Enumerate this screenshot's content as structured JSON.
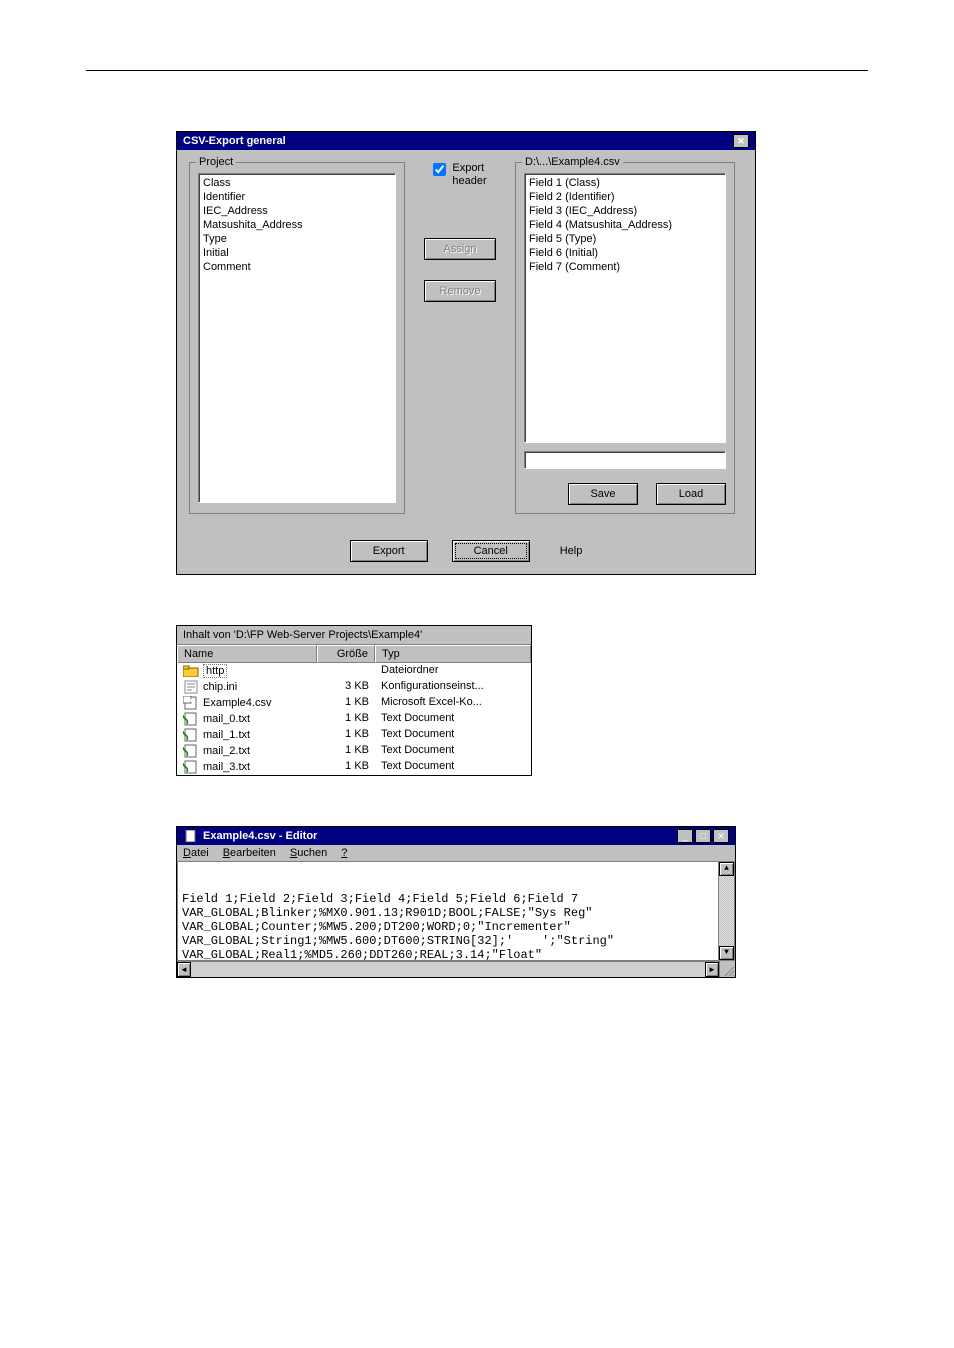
{
  "dialog": {
    "title": "CSV-Export general",
    "project_legend": "Project",
    "project_items": "Class\nIdentifier\nIEC_Address\nMatsushita_Address\nType\nInitial\nComment",
    "export_header_label": "Export\nheader",
    "assign_label": "Assign",
    "remove_label": "Remove",
    "dest_legend": "D:\\...\\Example4.csv",
    "dest_items": "Field 1 (Class)\nField 2 (Identifier)\nField 3 (IEC_Address)\nField 4 (Matsushita_Address)\nField 5 (Type)\nField 6 (Initial)\nField 7 (Comment)",
    "save_label": "Save",
    "load_label": "Load",
    "export_label": "Export",
    "cancel_label": "Cancel",
    "help_label": "Help"
  },
  "explorer": {
    "header": "Inhalt von 'D:\\FP Web-Server Projects\\Example4'",
    "col_name": "Name",
    "col_size": "Größe",
    "col_type": "Typ",
    "rows": [
      {
        "icon": "folder",
        "name": "http",
        "selected": true,
        "size": "",
        "type": "Dateiordner"
      },
      {
        "icon": "ini",
        "name": "chip.ini",
        "selected": false,
        "size": "3 KB",
        "type": "Konfigurationseinst..."
      },
      {
        "icon": "csv",
        "name": "Example4.csv",
        "selected": false,
        "size": "1 KB",
        "type": "Microsoft Excel-Ko..."
      },
      {
        "icon": "txt",
        "name": "mail_0.txt",
        "selected": false,
        "size": "1 KB",
        "type": "Text Document"
      },
      {
        "icon": "txt",
        "name": "mail_1.txt",
        "selected": false,
        "size": "1 KB",
        "type": "Text Document"
      },
      {
        "icon": "txt",
        "name": "mail_2.txt",
        "selected": false,
        "size": "1 KB",
        "type": "Text Document"
      },
      {
        "icon": "txt",
        "name": "mail_3.txt",
        "selected": false,
        "size": "1 KB",
        "type": "Text Document"
      }
    ]
  },
  "editor": {
    "title": "Example4.csv - Editor",
    "menu": {
      "datei": "Datei",
      "bearbeiten": "Bearbeiten",
      "suchen": "Suchen",
      "help": "?"
    },
    "content": "Field 1;Field 2;Field 3;Field 4;Field 5;Field 6;Field 7\nVAR_GLOBAL;Blinker;%MX0.901.13;R901D;BOOL;FALSE;\"Sys Reg\"\nVAR_GLOBAL;Counter;%MW5.200;DT200;WORD;0;\"Incrementer\"\nVAR_GLOBAL;String1;%MW5.600;DT600;STRING[32];'    ';\"String\"\nVAR_GLOBAL;Real1;%MD5.260;DDT260;REAL;3.14;\"Float\""
  }
}
